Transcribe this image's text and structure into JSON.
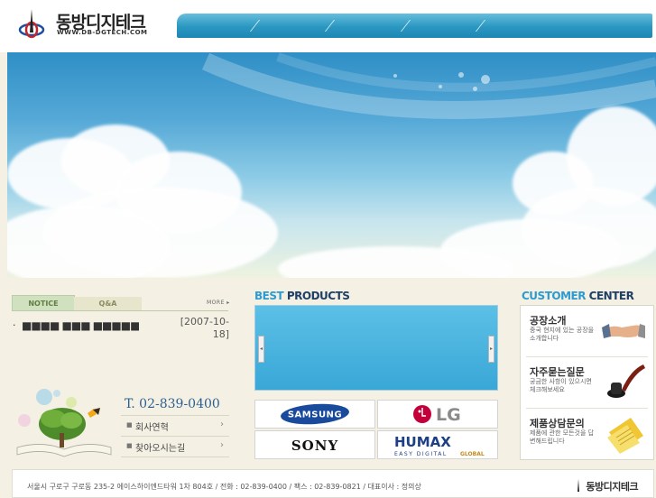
{
  "header": {
    "company_name": "동방디지테크",
    "url": "WWW.DB-DGTECH.COM"
  },
  "notice": {
    "tab_notice": "NOTICE",
    "tab_qa": "Q&A",
    "more": "MORE ▸",
    "items": [
      {
        "title": "■■■■ ■■■ ■■■■■■",
        "date": "[2007-10-18]"
      }
    ]
  },
  "contact": {
    "phone": "T. 02-839-0400",
    "links": [
      {
        "label": "회사연혁"
      },
      {
        "label": "찾아오시는길"
      }
    ]
  },
  "best_products": {
    "title_a": "BEST",
    "title_b": "PRODUCTS",
    "brands": [
      "SAMSUNG",
      "LG",
      "SONY",
      "HUMAX",
      "EASY DIGITAL",
      "GLOBAL"
    ]
  },
  "customer_center": {
    "title_a": "CUSTOMER",
    "title_b": "CENTER",
    "items": [
      {
        "title": "공장소개",
        "desc": "중국 현지에 있는 공장을 소개합니다"
      },
      {
        "title": "자주묻는질문",
        "desc": "궁금한 사항이 있으시면 체크해보세요"
      },
      {
        "title": "제품상담문의",
        "desc": "제품에 관한 모든것을 답변해드립니다"
      }
    ]
  },
  "footer": {
    "address": "서울시 구로구 구로동 235-2 에이스하이엔드타워 1차 804호 / 전화 : 02-839-0400 / 팩스 : 02-839-0821 / 대표이사 : 정의상",
    "logo_text": "동방디지테크"
  },
  "colors": {
    "nav": "#2a97c1",
    "accent_blue": "#2e9bd0",
    "navy": "#1f3f66",
    "background": "#f4f1e4"
  }
}
